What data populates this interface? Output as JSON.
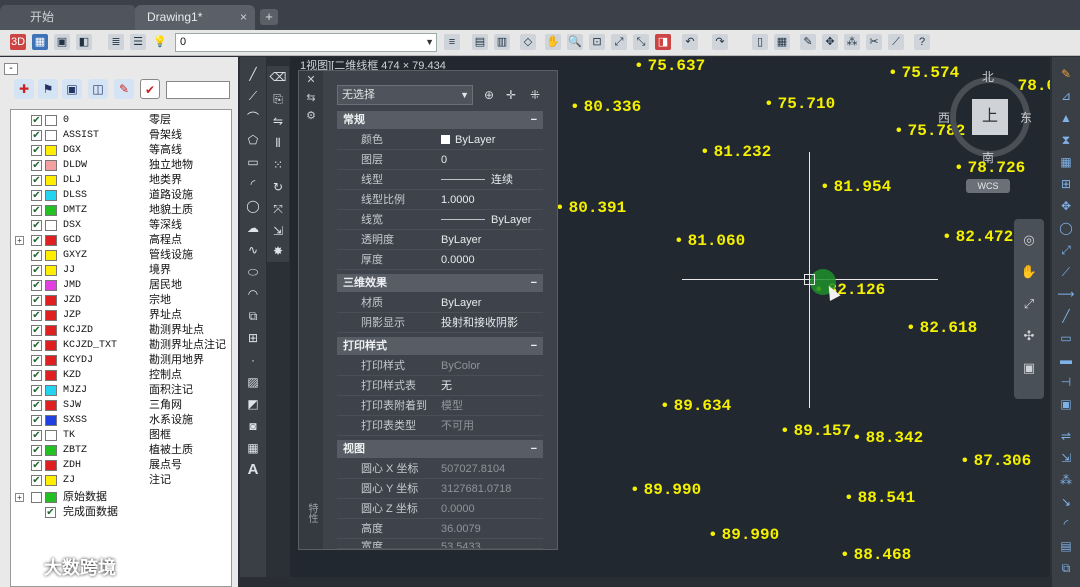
{
  "tabs": [
    {
      "label": "开始"
    },
    {
      "label": "Drawing1*",
      "close": "×"
    }
  ],
  "tab_add": "+",
  "toolbar": {
    "current_layer": "0",
    "icons": [
      "3d-icon",
      "view-icon",
      "layer-state-icon",
      "save-icon",
      "layer-match-icon",
      "bulb-icon"
    ]
  },
  "layer_panel": {
    "collapse": "-",
    "layers": [
      {
        "name": "0",
        "desc": "零层",
        "color": "#ffffff"
      },
      {
        "name": "ASSIST",
        "desc": "骨架线",
        "color": "#ffffff"
      },
      {
        "name": "DGX",
        "desc": "等高线",
        "color": "#ffee00"
      },
      {
        "name": "DLDW",
        "desc": "独立地物",
        "color": "#f2a0a0"
      },
      {
        "name": "DLJ",
        "desc": "地类界",
        "color": "#ffee00"
      },
      {
        "name": "DLSS",
        "desc": "道路设施",
        "color": "#22d4f0"
      },
      {
        "name": "DMTZ",
        "desc": "地貌土质",
        "color": "#22c022"
      },
      {
        "name": "DSX",
        "desc": "等深线",
        "color": "#ffffff"
      },
      {
        "name": "GCD",
        "desc": "高程点",
        "color": "#e02020",
        "expand": "+"
      },
      {
        "name": "GXYZ",
        "desc": "管线设施",
        "color": "#ffee00"
      },
      {
        "name": "JJ",
        "desc": "境界",
        "color": "#ffee00"
      },
      {
        "name": "JMD",
        "desc": "居民地",
        "color": "#e040e0"
      },
      {
        "name": "JZD",
        "desc": "宗地",
        "color": "#e02020"
      },
      {
        "name": "JZP",
        "desc": "界址点",
        "color": "#e02020"
      },
      {
        "name": "KCJZD",
        "desc": "勘测界址点",
        "color": "#e02020"
      },
      {
        "name": "KCJZD_TXT",
        "desc": "勘测界址点注记",
        "color": "#e02020"
      },
      {
        "name": "KCYDJ",
        "desc": "勘测用地界",
        "color": "#e02020"
      },
      {
        "name": "KZD",
        "desc": "控制点",
        "color": "#e02020"
      },
      {
        "name": "MJZJ",
        "desc": "面积注记",
        "color": "#22d4f0"
      },
      {
        "name": "SJW",
        "desc": "三角网",
        "color": "#e02020"
      },
      {
        "name": "SXSS",
        "desc": "水系设施",
        "color": "#2040e0"
      },
      {
        "name": "TK",
        "desc": "图框",
        "color": "#ffffff"
      },
      {
        "name": "ZBTZ",
        "desc": "植被土质",
        "color": "#22c022"
      },
      {
        "name": "ZDH",
        "desc": "展点号",
        "color": "#e02020"
      },
      {
        "name": "ZJ",
        "desc": "注记",
        "color": "#ffee00"
      }
    ],
    "groups": [
      {
        "label": "原始数据",
        "expand": "+",
        "color": "#22c022"
      },
      {
        "label": "完成面数据"
      }
    ]
  },
  "properties": {
    "selection": "无选择",
    "sections": {
      "general": "常规",
      "effects": "三维效果",
      "print": "打印样式",
      "view": "视图"
    },
    "collapse": "−",
    "general_rows": [
      {
        "k": "颜色",
        "v": "ByLayer"
      },
      {
        "k": "图层",
        "v": "0"
      },
      {
        "k": "线型",
        "v": "连续"
      },
      {
        "k": "线型比例",
        "v": "1.0000"
      },
      {
        "k": "线宽",
        "v": "ByLayer"
      },
      {
        "k": "透明度",
        "v": "ByLayer"
      },
      {
        "k": "厚度",
        "v": "0.0000"
      }
    ],
    "effects_rows": [
      {
        "k": "材质",
        "v": "ByLayer"
      },
      {
        "k": "阴影显示",
        "v": "投射和接收阴影"
      }
    ],
    "print_rows": [
      {
        "k": "打印样式",
        "v": "ByColor"
      },
      {
        "k": "打印样式表",
        "v": "无"
      },
      {
        "k": "打印表附着到",
        "v": "模型"
      },
      {
        "k": "打印表类型",
        "v": "不可用"
      }
    ],
    "view_rows": [
      {
        "k": "圆心 X 坐标",
        "v": "507027.8104"
      },
      {
        "k": "圆心 Y 坐标",
        "v": "3127681.0718"
      },
      {
        "k": "圆心 Z 坐标",
        "v": "0.0000"
      },
      {
        "k": "高度",
        "v": "36.0079"
      },
      {
        "k": "宽度",
        "v": "53.5433"
      }
    ],
    "strip_label": "特性"
  },
  "canvas": {
    "coord_text": "1视图][二维线框 474 × 79.434",
    "points": [
      "75.637",
      "75.574",
      "78.6",
      "80.336",
      "75.710",
      "75.782",
      "81.232",
      "78.726",
      "81.954",
      "80.391",
      "82.472",
      "81.060",
      "82.126",
      "82.618",
      "89.634",
      "89.157",
      "88.342",
      "87.306",
      "89.990",
      "88.541",
      "89.990",
      "88.468"
    ]
  },
  "viewcube": {
    "top": "上",
    "north": "北",
    "south": "南",
    "east": "东",
    "west": "西",
    "wcs": "WCS"
  },
  "watermark": "大数跨境"
}
